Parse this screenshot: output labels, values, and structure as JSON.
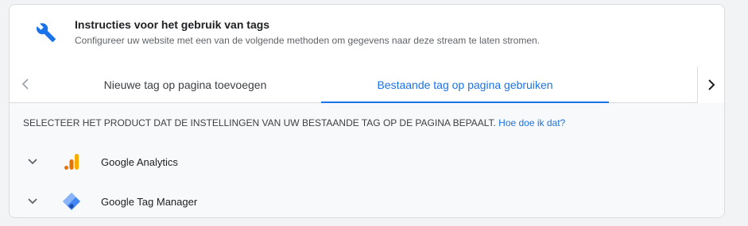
{
  "header": {
    "icon": "wrench-icon",
    "title": "Instructies voor het gebruik van tags",
    "subtitle": "Configureer uw website met een van de volgende methoden om gegevens naar deze stream te laten stromen."
  },
  "tabs": {
    "prev_icon": "chevron-left-icon",
    "next_icon": "chevron-right-icon",
    "items": [
      {
        "label": "Nieuwe tag op pagina toevoegen",
        "active": false
      },
      {
        "label": "Bestaande tag op pagina gebruiken",
        "active": true
      }
    ]
  },
  "instruction": {
    "text": "SELECTEER HET PRODUCT DAT DE INSTELLINGEN VAN UW BESTAANDE TAG OP DE PAGINA BEPAALT.",
    "link": "Hoe doe ik dat?"
  },
  "products": [
    {
      "label": "Google Analytics",
      "icon": "google-analytics-icon"
    },
    {
      "label": "Google Tag Manager",
      "icon": "google-tag-manager-icon"
    }
  ],
  "colors": {
    "accent": "#1a73e8",
    "analytics_orange": "#f9ab00",
    "analytics_dark_orange": "#e37400",
    "gtm_blue": "#4285f4",
    "gtm_light_blue": "#8ab4f8"
  }
}
